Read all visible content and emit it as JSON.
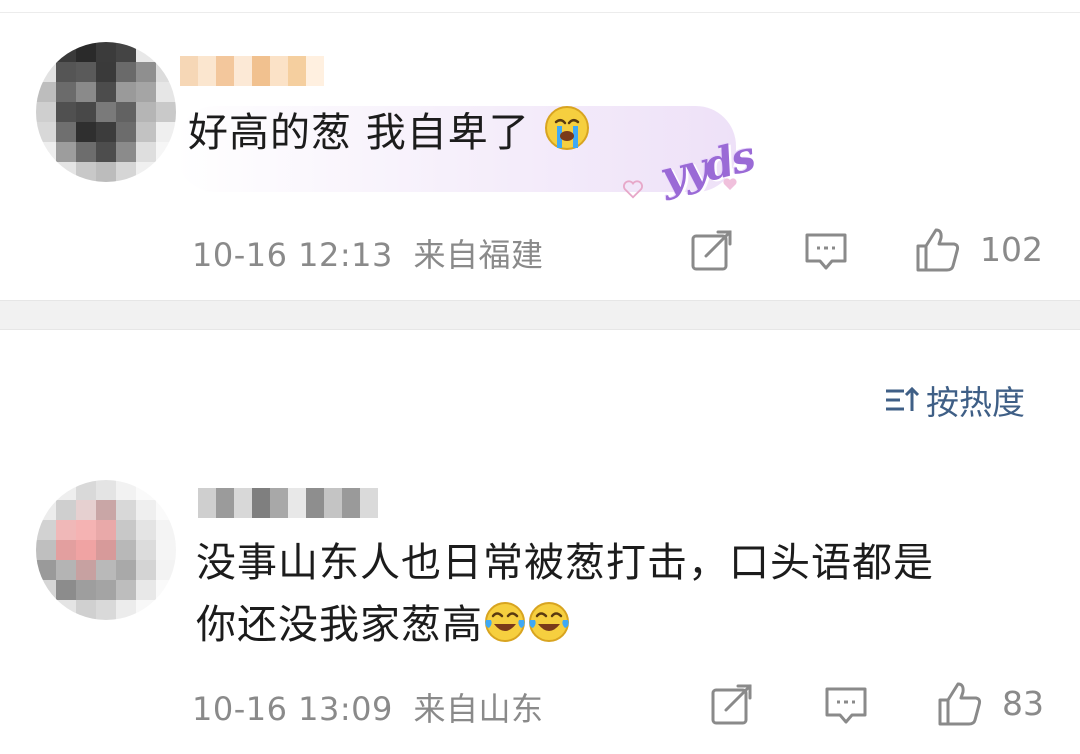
{
  "comments": [
    {
      "text": "好高的葱 我自卑了",
      "emoji": "loudly-crying-face",
      "sticker": "yyds",
      "time": "10-16 12:13",
      "location": "来自福建",
      "likes": "102"
    },
    {
      "text_line1": "没事山东人也日常被葱打击，口头语都是",
      "text_line2": "你还没我家葱高",
      "emoji": "tears-of-joy",
      "time": "10-16 13:09",
      "location": "来自山东",
      "likes": "83"
    }
  ],
  "sort": {
    "label": "按热度",
    "icon": "sort-icon"
  },
  "icons": [
    "share-icon",
    "comment-icon",
    "like-icon"
  ],
  "colors": {
    "meta_text": "#8a8a8a",
    "sort_text": "#3f5f86",
    "separator": "#f1f1f1"
  }
}
